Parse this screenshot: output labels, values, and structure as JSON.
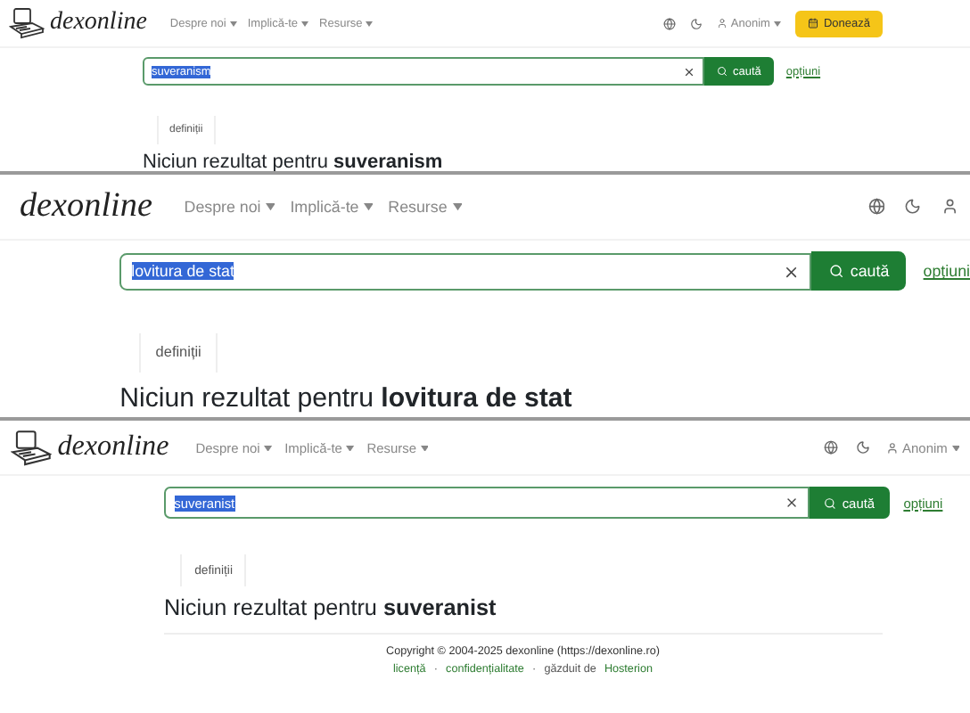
{
  "panels": [
    {
      "logo": {
        "icon": true,
        "text": "dexonline"
      },
      "nav": [
        {
          "label": "Despre noi"
        },
        {
          "label": "Implică-te"
        },
        {
          "label": "Resurse"
        }
      ],
      "user": "Anonim",
      "donate": "Donează",
      "search": {
        "value": "suveranism",
        "highlighted": true,
        "button": "caută",
        "options_link": "opțiuni"
      },
      "tabs": [
        {
          "label": "definiții",
          "selected": true
        }
      ],
      "result": "Niciun rezultat pentru **suveranism**"
    },
    {
      "logo": {
        "icon": false,
        "text": "dexonline"
      },
      "nav": [
        {
          "label": "Despre noi"
        },
        {
          "label": "Implică-te"
        },
        {
          "label": "Resurse"
        }
      ],
      "search": {
        "value": "lovitura de stat",
        "highlighted": true,
        "button": "caută",
        "options_link": "opțiuni"
      },
      "tabs": [
        {
          "label": "definiții",
          "selected": true
        }
      ],
      "result": "Niciun rezultat pentru **lovitura de stat**"
    },
    {
      "logo": {
        "icon": true,
        "text": "dexonline"
      },
      "nav": [
        {
          "label": "Despre noi"
        },
        {
          "label": "Implică-te"
        },
        {
          "label": "Resurse"
        }
      ],
      "user": "Anonim",
      "search": {
        "value": "suveranist",
        "highlighted": true,
        "button": "caută",
        "options_link": "opțiuni"
      },
      "tabs": [
        {
          "label": "definiții",
          "selected": true
        }
      ],
      "result": "Niciun rezultat pentru **suveranist**",
      "footer": {
        "copyright": "Copyright © 2004-2025 dexonline (https://dexonline.ro)",
        "items": [
          {
            "kind": "link",
            "label": "licență"
          },
          {
            "kind": "separator",
            "label": "·"
          },
          {
            "kind": "link",
            "label": "confidențialitate"
          },
          {
            "kind": "separator",
            "label": "·"
          },
          {
            "kind": "text",
            "label": "găzduit de"
          },
          {
            "kind": "link",
            "label": "Hosterion"
          }
        ]
      }
    }
  ]
}
